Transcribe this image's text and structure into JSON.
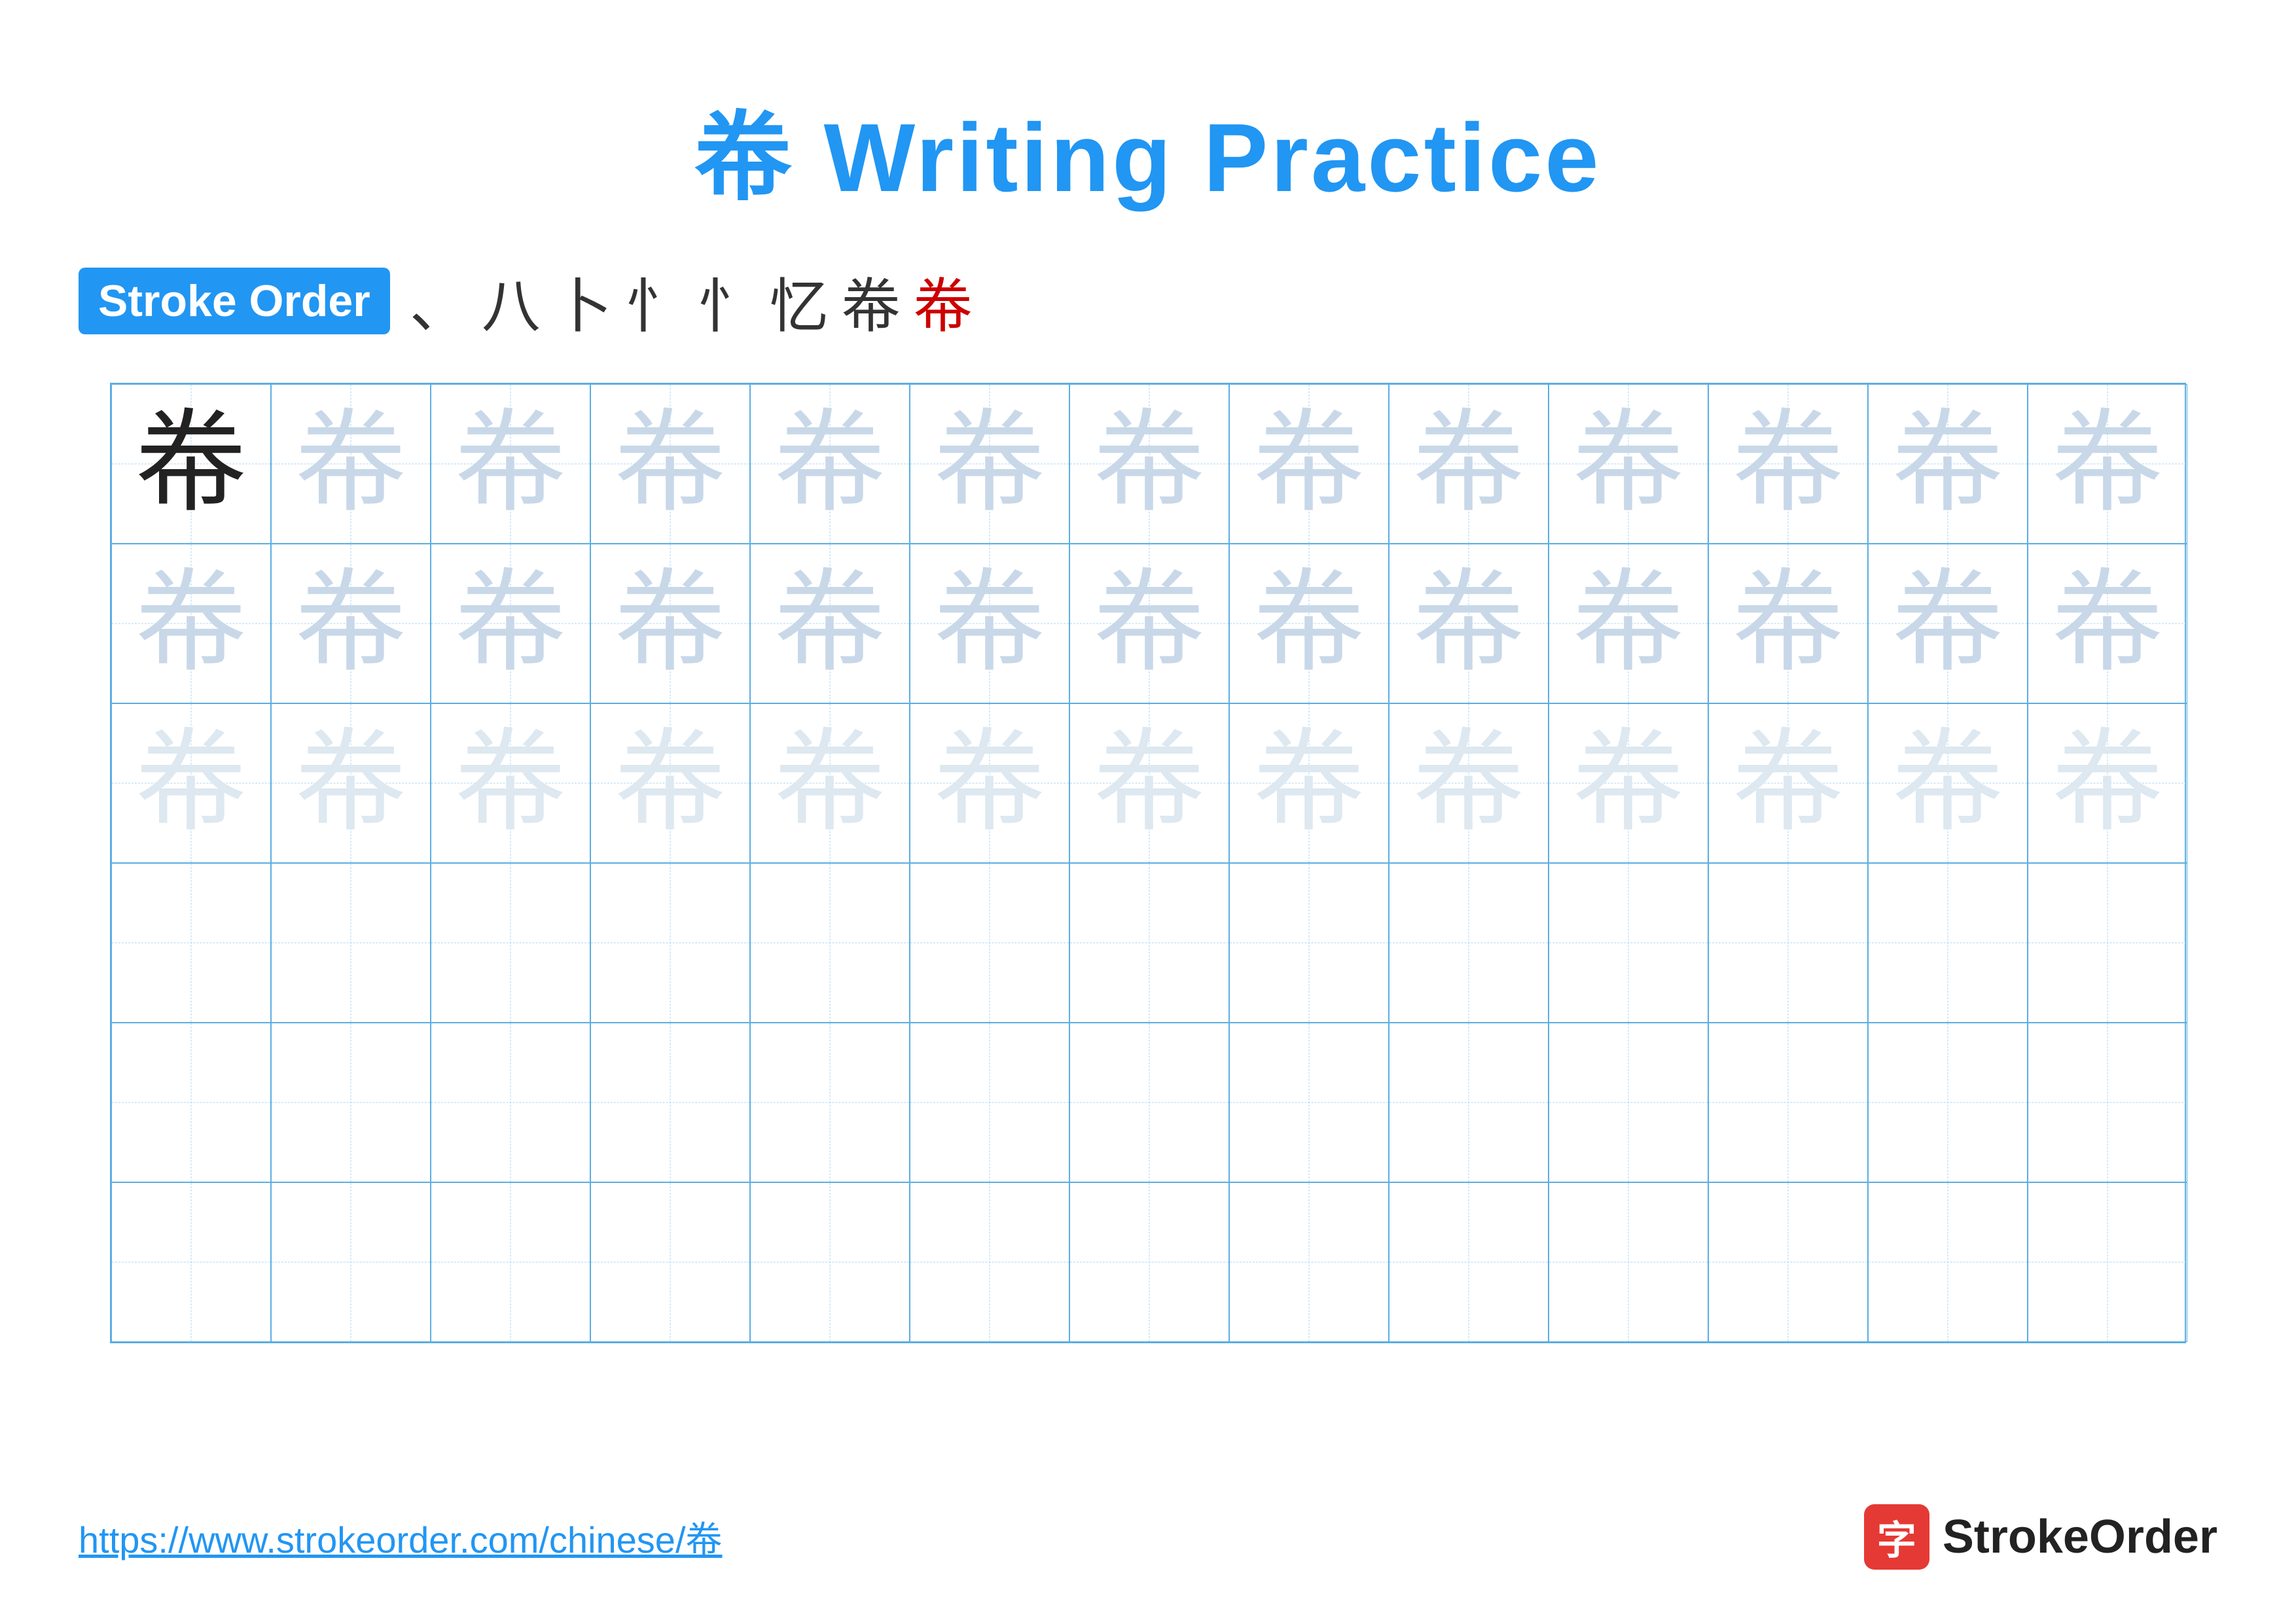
{
  "page": {
    "title": "帣 Writing Practice",
    "stroke_order_badge": "Stroke Order",
    "stroke_sequence": [
      "、",
      "八",
      "卜",
      "忄",
      "忄",
      "忆",
      "帣",
      "帣"
    ],
    "last_stroke_index": 7,
    "character": "帣",
    "rows": [
      {
        "type": "dark",
        "count": 1,
        "light_count": 12
      },
      {
        "type": "light1",
        "count": 13
      },
      {
        "type": "lighter",
        "count": 13
      },
      {
        "type": "empty",
        "count": 13
      },
      {
        "type": "empty",
        "count": 13
      },
      {
        "type": "empty",
        "count": 13
      }
    ],
    "footer_url": "https://www.strokeorder.com/chinese/帣",
    "footer_logo_char": "字",
    "footer_logo_text": "StrokeOrder"
  }
}
